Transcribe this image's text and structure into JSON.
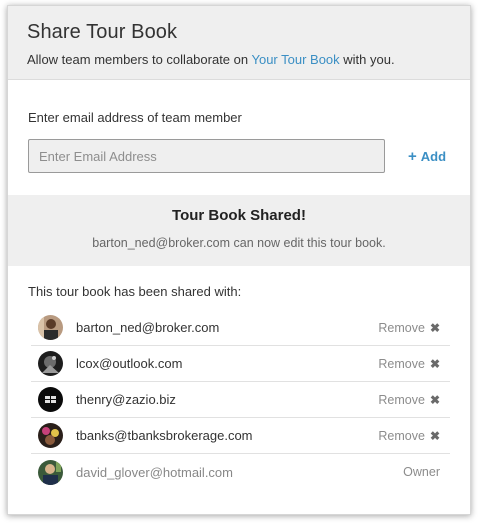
{
  "header": {
    "title": "Share Tour Book",
    "subtitle_prefix": "Allow team members to collaborate on ",
    "subtitle_link": "Your Tour Book",
    "subtitle_suffix": " with you."
  },
  "email_form": {
    "label": "Enter email address of team member",
    "placeholder": "Enter Email Address",
    "value": "",
    "add_label": "Add",
    "add_icon": "+"
  },
  "banner": {
    "title": "Tour Book Shared!",
    "message": "barton_ned@broker.com can now edit this tour book."
  },
  "shared_list": {
    "heading": "This tour book has been shared with:",
    "remove_label": "Remove",
    "remove_icon": "✖",
    "owner_label": "Owner",
    "users": [
      {
        "email": "barton_ned@broker.com"
      },
      {
        "email": "lcox@outlook.com"
      },
      {
        "email": "thenry@zazio.biz"
      },
      {
        "email": "tbanks@tbanksbrokerage.com"
      },
      {
        "email": "david_glover@hotmail.com"
      }
    ]
  }
}
